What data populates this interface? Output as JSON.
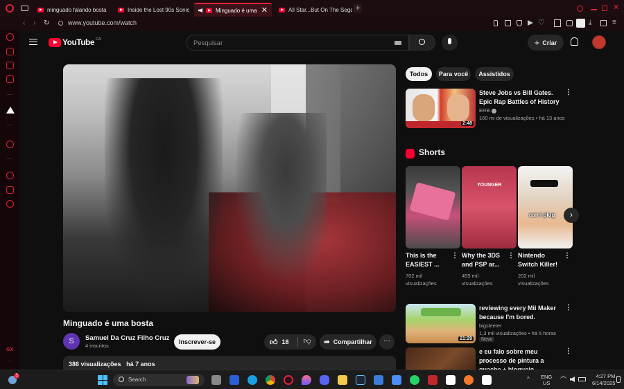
{
  "browser": {
    "tabs": [
      {
        "label": "minguado falando bosta"
      },
      {
        "label": "Inside the Lost 90s Sonic"
      },
      {
        "label": "Minguado é uma"
      },
      {
        "label": "All Star...But On The Sega"
      }
    ],
    "url": "www.youtube.com/watch"
  },
  "youtube": {
    "logo_text": "YouTube",
    "region": "CA",
    "search_placeholder": "Pesquisar",
    "create_label": "Criar",
    "chips": [
      "Todos",
      "Para você",
      "Assistidos"
    ],
    "video": {
      "title": "Minguado é uma bosta",
      "channel": "Samuel Da Cruz Filho Cruz",
      "channel_initial": "S",
      "subscribers": "4 inscritos",
      "subscribe_label": "Inscrever-se",
      "likes": "18",
      "share_label": "Compartilhar",
      "views": "386 visualizações",
      "age": "há 7 anos"
    },
    "recommended": [
      {
        "title": "Steve Jobs vs Bill Gates. Epic Rap Battles of History",
        "channel": "ERB",
        "views": "160 mi de visualizações",
        "age": "há 13 anos",
        "duration": "2:48"
      },
      {
        "title": "reviewing every Mii Maker because I'm bored.",
        "channel": "bigsleeter",
        "views": "1,3 mil visualizações",
        "age": "há 5 horas",
        "badge": "Novo",
        "duration": "21:29"
      },
      {
        "title": "e eu falo sobre meu processo de pintura a guache + bloqueio...",
        "channel": "",
        "views": "",
        "age": "",
        "duration": ""
      }
    ],
    "shorts_heading": "Shorts",
    "shorts": [
      {
        "title": "This is the EASIEST ...",
        "views": "702 mil visualizações"
      },
      {
        "title": "Why the 3DS and PSP ar...",
        "views": "455 mil visualizações",
        "overlay": "YOUNGER"
      },
      {
        "title": "Nintendo Switch Killer!",
        "views": "202 mil visualizações",
        "overlay": "can I plug"
      }
    ]
  },
  "taskbar": {
    "search_label": "Search",
    "language": "ENG",
    "region": "US",
    "time": "4:27 PM",
    "date": "6/14/2025",
    "notification_count": "3"
  },
  "colors": {
    "opera_red": "#e0233a",
    "youtube_red": "#ff0033",
    "background": "#0f0f0f"
  }
}
